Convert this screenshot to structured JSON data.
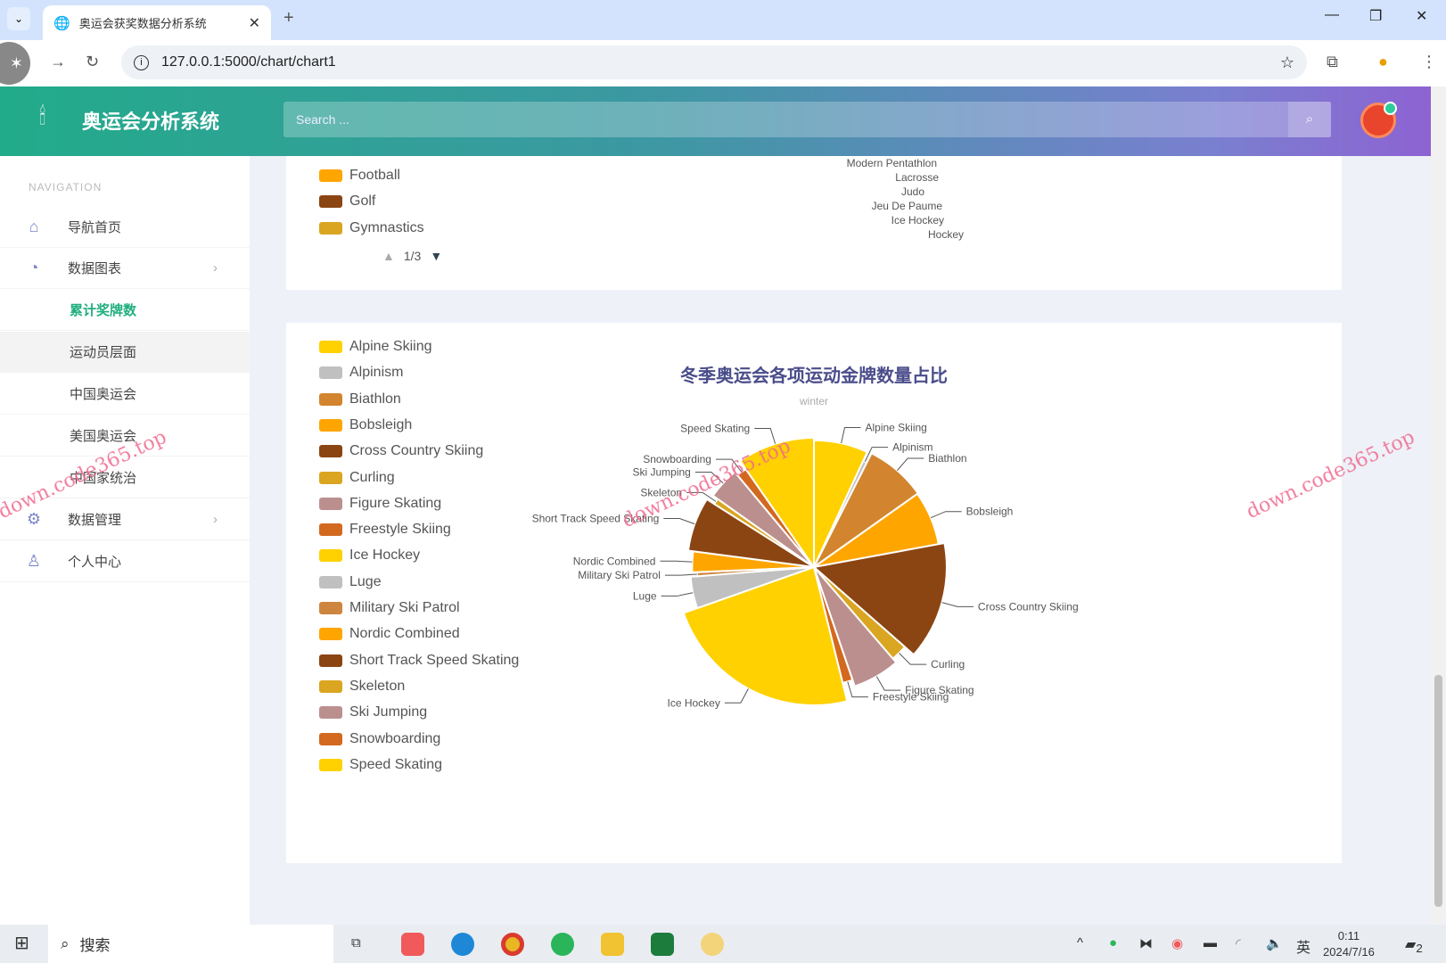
{
  "browser": {
    "tab_title": "奥运会获奖数据分析系统",
    "url": "127.0.0.1:5000/chart/chart1"
  },
  "header": {
    "title": "奥运会分析系统",
    "search_placeholder": "Search ..."
  },
  "sidebar": {
    "heading": "NAVIGATION",
    "items": [
      {
        "label": "导航首页",
        "icon": "home-icon"
      },
      {
        "label": "数据图表",
        "icon": "pie-chart-icon",
        "expanded": true,
        "children": [
          {
            "label": "累计奖牌数",
            "active": true
          },
          {
            "label": "运动员层面"
          },
          {
            "label": "中国奥运会"
          },
          {
            "label": "美国奥运会"
          },
          {
            "label": "中国家统治"
          }
        ]
      },
      {
        "label": "数据管理",
        "icon": "gear-icon"
      },
      {
        "label": "个人中心",
        "icon": "user-icon"
      }
    ]
  },
  "top_chart": {
    "legend": [
      {
        "name": "Football",
        "color": "#FFA500"
      },
      {
        "name": "Golf",
        "color": "#8B4513"
      },
      {
        "name": "Gymnastics",
        "color": "#DAA520"
      }
    ],
    "pager": "1/3",
    "labels": [
      "Modern Pentathlon",
      "Lacrosse",
      "Judo",
      "Jeu De Paume",
      "Ice Hockey",
      "Hockey"
    ]
  },
  "chart_data": {
    "type": "pie",
    "title": "冬季奥运会各项运动金牌数量占比",
    "subtitle": "winter",
    "legend_placement": "left",
    "legend_page": "",
    "categories": [
      "Alpine Skiing",
      "Alpinism",
      "Biathlon",
      "Bobsleigh",
      "Cross Country Skiing",
      "Curling",
      "Figure Skating",
      "Freestyle Skiing",
      "Ice Hockey",
      "Luge",
      "Military Ski Patrol",
      "Nordic Combined",
      "Short Track Speed Skating",
      "Skeleton",
      "Ski Jumping",
      "Snowboarding",
      "Speed Skating"
    ],
    "values": [
      25,
      2,
      28,
      25,
      52,
      8,
      22,
      5,
      85,
      15,
      2,
      10,
      25,
      3,
      15,
      5,
      35
    ],
    "colors": [
      "#FFD100",
      "#C0C0C0",
      "#D2852E",
      "#FFA500",
      "#8B4513",
      "#DAA520",
      "#BC8F8F",
      "#D2691E",
      "#FFD100",
      "#C0C0C0",
      "#CD853F",
      "#FFA500",
      "#8B4513",
      "#DAA520",
      "#BC8F8F",
      "#D2691E",
      "#FFD100"
    ]
  },
  "taskbar": {
    "search": "搜索",
    "time": "0:11",
    "date": "2024/7/16",
    "ime": "英",
    "notifications": "2"
  },
  "watermark": "down.code365.top"
}
